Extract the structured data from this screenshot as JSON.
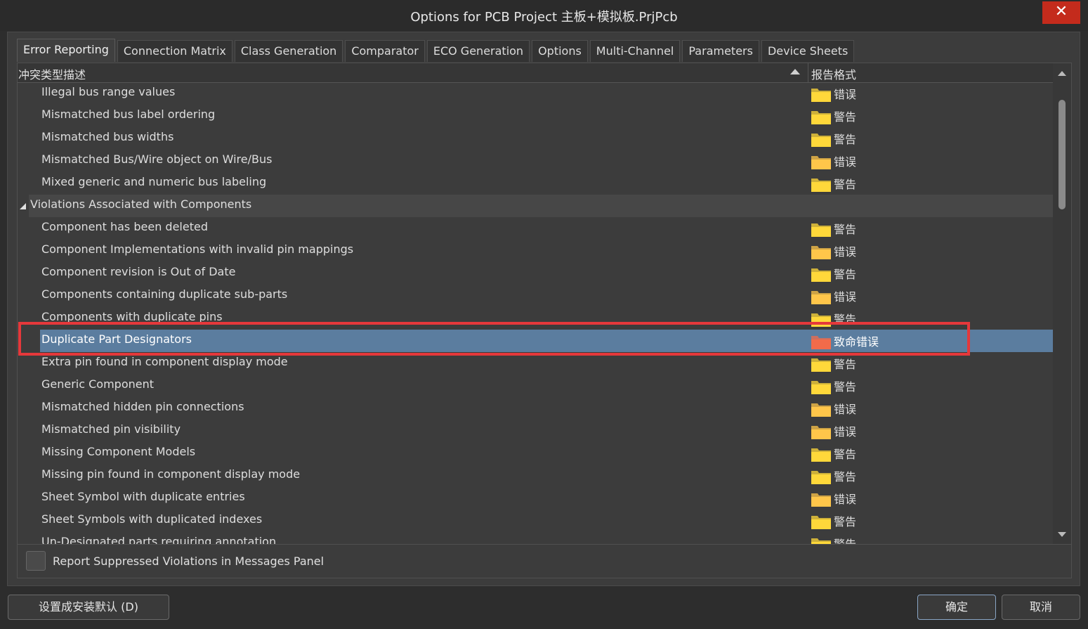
{
  "window": {
    "title": "Options for PCB Project 主板+模拟板.PrjPcb",
    "close_glyph": "✕"
  },
  "tabs": [
    {
      "label": "Error Reporting",
      "active": true
    },
    {
      "label": "Connection Matrix",
      "active": false
    },
    {
      "label": "Class Generation",
      "active": false
    },
    {
      "label": "Comparator",
      "active": false
    },
    {
      "label": "ECO Generation",
      "active": false
    },
    {
      "label": "Options",
      "active": false
    },
    {
      "label": "Multi-Channel",
      "active": false
    },
    {
      "label": "Parameters",
      "active": false
    },
    {
      "label": "Device Sheets",
      "active": false
    }
  ],
  "grid": {
    "col_description": "冲突类型描述",
    "col_report": "报告格式",
    "rows": [
      {
        "label": "Illegal bus range values",
        "status": "错误",
        "folder_color": "#ffd83a"
      },
      {
        "label": "Mismatched bus label ordering",
        "status": "警告",
        "folder_color": "#ffd83a"
      },
      {
        "label": "Mismatched bus widths",
        "status": "警告",
        "folder_color": "#ffd83a"
      },
      {
        "label": "Mismatched Bus/Wire object on Wire/Bus",
        "status": "错误",
        "folder_color": "#ffc64a"
      },
      {
        "label": "Mixed generic and numeric bus labeling",
        "status": "警告",
        "folder_color": "#ffd83a"
      },
      {
        "label": "Violations Associated with Components",
        "group": true
      },
      {
        "label": "Component has been deleted",
        "status": "警告",
        "folder_color": "#ffd83a"
      },
      {
        "label": "Component Implementations with invalid pin mappings",
        "status": "错误",
        "folder_color": "#ffc64a"
      },
      {
        "label": "Component revision is Out of Date",
        "status": "警告",
        "folder_color": "#ffd83a"
      },
      {
        "label": "Components containing duplicate sub-parts",
        "status": "错误",
        "folder_color": "#ffc64a"
      },
      {
        "label": "Components with duplicate pins",
        "status": "警告",
        "folder_color": "#ffd83a"
      },
      {
        "label": "Duplicate Part Designators",
        "status": "致命错误",
        "folder_color": "#f26b4a",
        "selected": true
      },
      {
        "label": "Extra pin found in component display mode",
        "status": "警告",
        "folder_color": "#ffd83a"
      },
      {
        "label": "Generic Component",
        "status": "警告",
        "folder_color": "#ffd83a"
      },
      {
        "label": "Mismatched hidden pin connections",
        "status": "错误",
        "folder_color": "#ffc64a"
      },
      {
        "label": "Mismatched pin visibility",
        "status": "错误",
        "folder_color": "#ffc64a"
      },
      {
        "label": "Missing Component Models",
        "status": "警告",
        "folder_color": "#ffd83a"
      },
      {
        "label": "Missing pin found in component display mode",
        "status": "警告",
        "folder_color": "#ffd83a"
      },
      {
        "label": "Sheet Symbol with duplicate entries",
        "status": "错误",
        "folder_color": "#ffc64a"
      },
      {
        "label": "Sheet Symbols with duplicated indexes",
        "status": "警告",
        "folder_color": "#ffd83a"
      },
      {
        "label": "Un-Designated parts requiring annotation",
        "status": "警告",
        "folder_color": "#ffd83a"
      }
    ]
  },
  "options": {
    "report_suppressed_label": "Report Suppressed Violations in Messages Panel",
    "report_suppressed_checked": false
  },
  "buttons": {
    "set_defaults": "设置成安装默认 (D)",
    "ok": "确定",
    "cancel": "取消"
  },
  "colors": {
    "selection": "#5b7d9f",
    "highlight_box": "#e5383b",
    "close_button": "#c42b1c"
  },
  "icons": {
    "sort": "sort-ascending-icon",
    "expander": "collapse-triangle-icon",
    "folder": "folder-icon"
  }
}
